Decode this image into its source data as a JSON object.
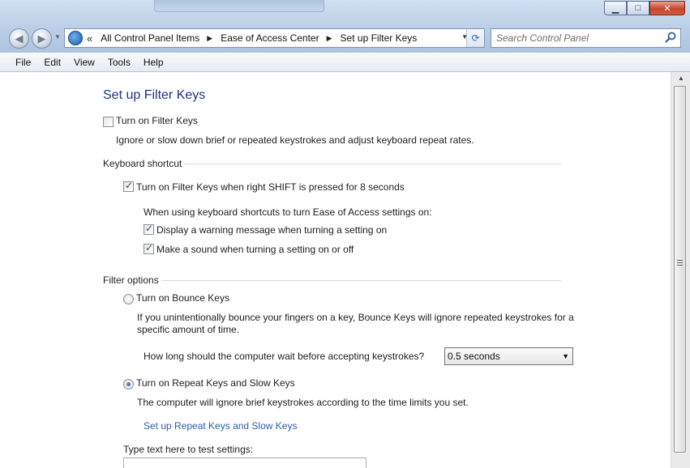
{
  "window": {
    "minimize_glyph": "▁",
    "maximize_glyph": "□",
    "close_glyph": "✕"
  },
  "nav": {
    "back_glyph": "◀",
    "forward_glyph": "▶",
    "history_glyph": "▼",
    "overflow_glyph": "«",
    "breadcrumb": [
      "All Control Panel Items",
      "Ease of Access Center",
      "Set up Filter Keys"
    ],
    "separator_glyph": "▶",
    "address_dropdown_glyph": "▼",
    "refresh_glyph": "⟳",
    "search_placeholder": "Search Control Panel"
  },
  "menu": [
    "File",
    "Edit",
    "View",
    "Tools",
    "Help"
  ],
  "page": {
    "title": "Set up Filter Keys",
    "filter_keys": {
      "label": "Turn on Filter Keys",
      "checked": false,
      "description": "Ignore or slow down brief or repeated keystrokes and adjust keyboard repeat rates."
    },
    "keyboard_shortcut": {
      "heading": "Keyboard shortcut",
      "shortcut_label": "Turn on Filter Keys when right SHIFT is pressed for 8 seconds",
      "shortcut_checked": true,
      "sub_heading": "When using keyboard shortcuts to turn Ease of Access settings on:",
      "warning_label": "Display a warning message when turning a setting on",
      "warning_checked": true,
      "sound_label": "Make a sound when turning a setting on or off",
      "sound_checked": true
    },
    "filter_options": {
      "heading": "Filter options",
      "bounce_label": "Turn on Bounce Keys",
      "bounce_selected": false,
      "bounce_desc_line1": "If you unintentionally bounce your fingers on a key, Bounce Keys will ignore repeated keystrokes for a",
      "bounce_desc_line2": "specific amount of time.",
      "wait_question": "How long should the computer wait before accepting keystrokes?",
      "wait_value": "0.5 seconds",
      "dropdown_glyph": "▼",
      "repeat_label": "Turn on Repeat Keys and Slow Keys",
      "repeat_selected": true,
      "repeat_desc": "The computer will ignore brief keystrokes according to the time limits you set.",
      "repeat_link": "Set up Repeat Keys and Slow Keys",
      "test_label": "Type text here to test settings:"
    }
  },
  "scrollbar": {
    "up_glyph": "▲"
  }
}
